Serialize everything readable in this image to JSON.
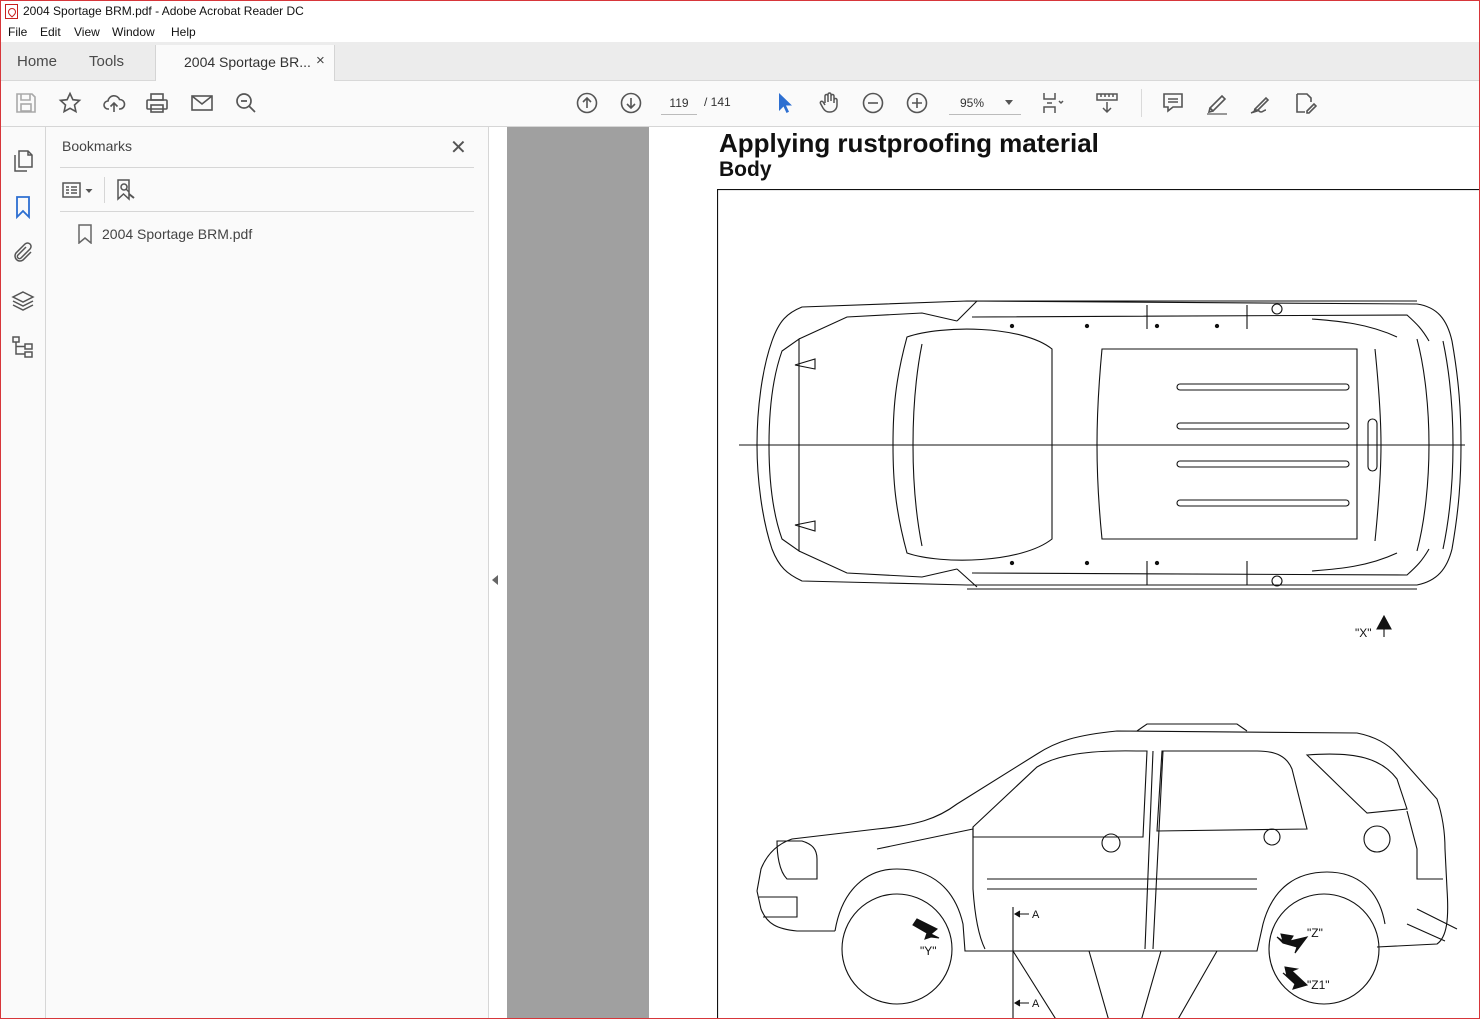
{
  "window": {
    "title": "2004 Sportage BRM.pdf - Adobe Acrobat Reader DC"
  },
  "menu": {
    "items": [
      "File",
      "Edit",
      "View",
      "Window",
      "Help"
    ]
  },
  "tabs": {
    "home": "Home",
    "tools": "Tools",
    "document": "2004 Sportage BR...",
    "close": "×"
  },
  "toolbar": {
    "page_current": "119",
    "page_total": "/ 141",
    "zoom": "95%",
    "icons": [
      "save-icon",
      "star-icon",
      "upload-icon",
      "print-icon",
      "email-icon",
      "search-icon",
      "page-up-icon",
      "page-down-icon",
      "select-arrow-icon",
      "hand-icon",
      "zoom-out-icon",
      "zoom-in-icon",
      "page-display-icon",
      "scroll-mode-icon",
      "comment-icon",
      "highlight-pen-icon",
      "sign-icon",
      "edit-pdf-icon"
    ]
  },
  "rail": {
    "icons": [
      "pages-icon",
      "bookmark-icon",
      "attachment-icon",
      "layers-icon",
      "tree-icon"
    ]
  },
  "bookmarks": {
    "header": "Bookmarks",
    "close": "✕",
    "items": [
      {
        "label": "2004 Sportage BRM.pdf"
      }
    ]
  },
  "document": {
    "title": "Applying rustproofing material",
    "subtitle": "Body",
    "labels": {
      "x": "\"X\"",
      "y": "\"Y\"",
      "z": "\"Z\"",
      "z1": "\"Z1\"",
      "a1": "A",
      "a2": "A"
    }
  },
  "colors": {
    "accent": "#2d6fd1",
    "frame": "#d7363a",
    "docbg": "#a0a0a0"
  }
}
